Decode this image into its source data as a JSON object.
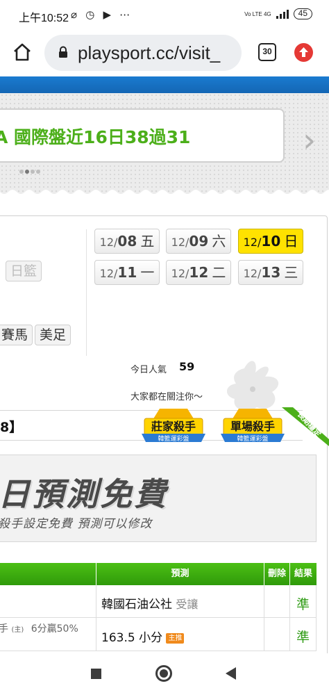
{
  "status_bar": {
    "time": "上午10:52",
    "icons": "⌀ ◷ ▶ ⋯",
    "network": "Vo LTE 4G",
    "battery": "45"
  },
  "browser": {
    "url": "playsport.cc/visit_",
    "tab_count": "30"
  },
  "news": {
    "headline": "A 國際盤近16日38過31",
    "slide_count": 4,
    "active_slide": 2
  },
  "sports": [
    {
      "label": "日籃",
      "faded": true
    },
    {
      "label": "賽馬",
      "faded": false
    },
    {
      "label": "美足",
      "faded": false
    }
  ],
  "dates": [
    {
      "md": "12/",
      "dd": "08",
      "wd": "五",
      "active": false
    },
    {
      "md": "12/",
      "dd": "09",
      "wd": "六",
      "active": false
    },
    {
      "md": "12/",
      "dd": "10",
      "wd": "日",
      "active": true
    },
    {
      "md": "12/",
      "dd": "11",
      "wd": "一",
      "active": false
    },
    {
      "md": "12/",
      "dd": "12",
      "wd": "二",
      "active": false
    },
    {
      "md": "12/",
      "dd": "13",
      "wd": "三",
      "active": false
    }
  ],
  "popularity": {
    "label": "今日人氣",
    "value": "59",
    "follow_text": "大家都在關注你～"
  },
  "bracket": "8】",
  "badges": [
    {
      "title": "莊家殺手",
      "sub": "韓籃運彩盤"
    },
    {
      "title": "單場殺手",
      "sub": "韓籃運彩盤"
    }
  ],
  "ribbon": "長期穩定",
  "promo": {
    "big": "日預測免費",
    "sub": "殺手設定免費 預測可以修改"
  },
  "table": {
    "headers": {
      "prediction": "預測",
      "delete": "刪除",
      "result": "結果"
    },
    "rows": [
      {
        "left": "",
        "pick": "韓國石油公社",
        "pick_note": "受讓",
        "tag": "",
        "result": "準"
      },
      {
        "left_mark": "手",
        "left_host": "(主)",
        "left_stats": "6分贏50%",
        "pick": "163.5 小分",
        "pick_note": "",
        "tag": "主推",
        "result": "準"
      }
    ]
  },
  "colors": {
    "brand_blue": "#1a7bd0",
    "headline_green": "#4caf1a",
    "table_green": "#3aa80f",
    "active_date": "#ffe200",
    "result_green": "#2e9b14"
  }
}
